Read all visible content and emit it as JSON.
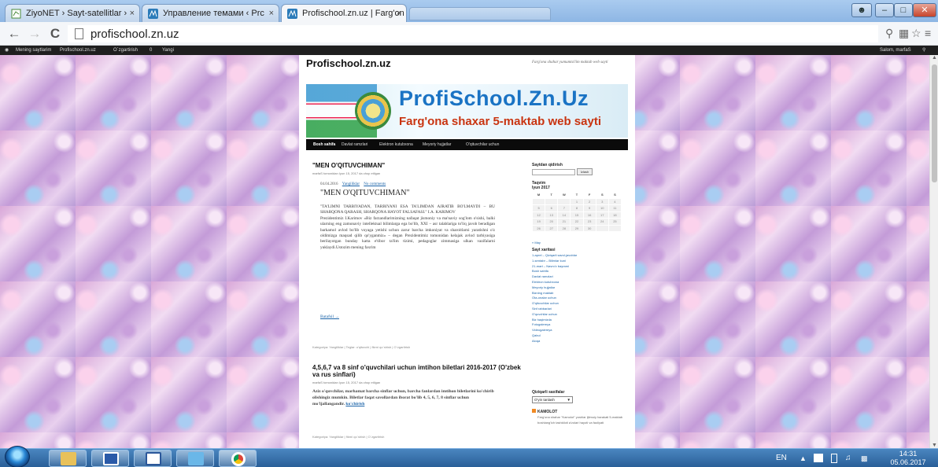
{
  "browser": {
    "tabs": [
      {
        "label": "ZiyoNET › Sayt-satellitlar ›",
        "active": false
      },
      {
        "label": "Управление темами ‹ Prc",
        "active": false
      },
      {
        "label": "Profischool.zn.uz | Farg'on",
        "active": true
      }
    ],
    "url": "profischool.zn.uz",
    "close_glyph": "×"
  },
  "wp_admin_bar": {
    "my_sites": "Mening saytlarim",
    "site": "Profischool.zn.uz",
    "edit": "O`zgartirish",
    "comments": "0",
    "new": "Yangi",
    "howdy": "Salom, marfaS"
  },
  "site": {
    "title": "Profischool.zn.uz",
    "description": "Farg'ona shahar yumumta'lim maktab web sayti",
    "banner_title": "ProfiSchool.Zn.Uz",
    "banner_subtitle": "Farg'ona shaxar 5-maktab web sayti",
    "menu": [
      "Bosh sahifa",
      "Davlat ramzlari",
      "Elektron kutubxona",
      "Meyoriy hujjatlar",
      "O'qituvchilar uchun"
    ]
  },
  "posts": [
    {
      "title": "\"MEN O'QITUVCHIMAN\"",
      "meta": "marfaS tomonidan Iyun 15, 2017 da chop etilgan",
      "date": "04.04.2016",
      "category": "Yangiliklar",
      "comments": "No comments",
      "inner_title": "\"MEN O'QITUVCHIMAN\"",
      "body": "\"TA'LIMNI TARBIYADAN, TARBIYANI ESA TA'LIMDAN AJRATIB BO'LMAYDI – BU SHARQONA QARASH, SHARQONA HAYOT FALSAFASI.\" I.A. KARIMOV\nPrezidentimiz I.Karimov «Biz farzandlarimizning nafaqat jismoniy va ma'naviy sog'lom o'sishi, balki ularning eng zamonaviy intellektual bilimlarga ega bo'lib, XXI – asr talablariga to'liq javob beradigan barkamol avlod bo'lib voyaga yetishi uchun zarur barcha imkoniyat va sharoitlarni yaratishni o'z oldimizga maqsad qilib qo'yganmiz» – degan Prezidentimiz tomonidan kelajak avlod tarbiyasiga berilayotgan bunday katta e'tibor ta'lim tizimi, pedagoglar zimmasiga ulkan vazifalarni yuklaydi.Ustozim mening faxrim",
      "read_more": "Batafsil →",
      "footer": "Kategoriya: Yangiliklar | Teglar: o'qituvchi | fikrni qo`shish | O`zgartirish"
    },
    {
      "title": "4,5,6,7 va 8 sinf o'quvchilari uchun imtihon biletlari 2016-2017 (O'zbek va rus sinflari)",
      "meta": "marfaS tomonidan Iyun 15, 2017 da chop etilgan",
      "body": "Aziz o'quvchilar, marhamat barcha sinflar uchun, barcha fanlardan imtihon biletlarini ko'chirib olishingiz mumkin. Biletlar faqat savollardan iborat bo'lib 4, 5, 6, 7, 8 sinflar uchun mo'ljallangandir.",
      "link": "ko'chirish",
      "footer": "Kategoriya: Yangiliklar | fikrni qo`shish | O`zgartirish"
    }
  ],
  "sidebar": {
    "search_title": "Saytdan qidirish",
    "search_button": "Izlash",
    "calendar_title": "Taqvim",
    "calendar_month": "Iyun 2017",
    "weekdays": [
      "M",
      "T",
      "W",
      "T",
      "F",
      "S",
      "S"
    ],
    "weeks": [
      [
        "",
        "",
        "",
        "1",
        "2",
        "3",
        "4"
      ],
      [
        "5",
        "6",
        "7",
        "8",
        "9",
        "10",
        "11"
      ],
      [
        "12",
        "13",
        "14",
        "15",
        "16",
        "17",
        "18"
      ],
      [
        "19",
        "20",
        "21",
        "22",
        "23",
        "24",
        "25"
      ],
      [
        "26",
        "27",
        "28",
        "29",
        "30",
        "",
        ""
      ]
    ],
    "calendar_prev": "« May",
    "sitemap_title": "Sayt xaritasi",
    "sitemap": [
      "1-aprel – Qiziqarli savol-javoblar",
      "1-sentabr – Bilimlar kuni",
      "21-mart – Navro'z bayrami",
      "Bosh sahifa",
      "Davlat ramzlari",
      "Elektron kutubxona",
      "Meyoriy hujjatlar",
      "Bizning maktab",
      "Ota-onalar uchun",
      "O'qituvchilar uchun",
      "Sinf rahbarlari",
      "O'quvchilar uchun",
      "Biz haqimizda",
      "Fotogalereya",
      "Videogalereya",
      "Qabul",
      "Aloqa"
    ],
    "categories_title": "Qiziqarli saxifalar",
    "categories_select": "O'yin tanlash",
    "kamolot_title": "KAMOLOT",
    "kamolot_text": "Farg'ona shahar \"Kamolot\" yoshlar ijtimoiy harakati 5-maktab boshlang'ich tashkiloti a'zolari hayoti va faoliyati"
  },
  "taskbar": {
    "lang": "EN",
    "time": "14:31",
    "date": "05.06.2017"
  }
}
